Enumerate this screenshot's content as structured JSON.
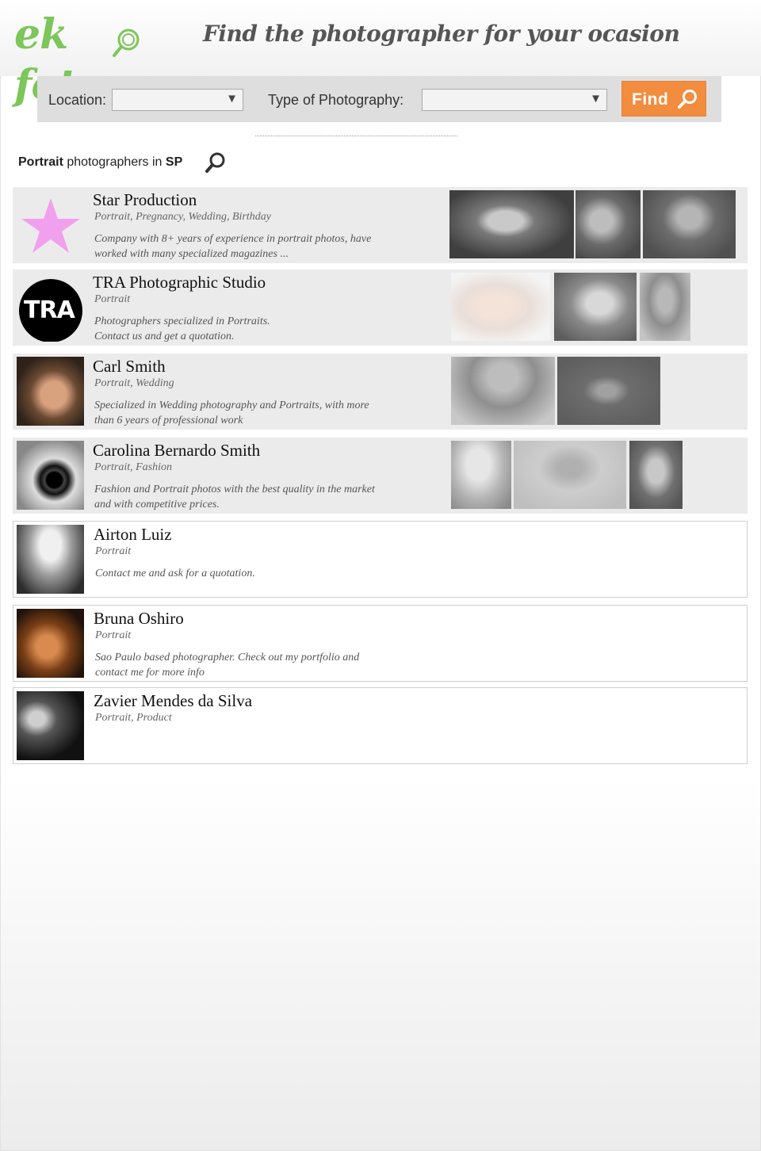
{
  "brand": {
    "logo_text": "ek foto",
    "tagline": "Find the photographer for your ocasion",
    "logo_color": "#7cc65a"
  },
  "search": {
    "location_label": "Location:",
    "location_value": "",
    "type_label": "Type of Photography:",
    "type_value": "",
    "find_label": "Find",
    "accent_color": "#f28c3f"
  },
  "results": {
    "heading_category": "Portrait",
    "heading_mid": " photographers in ",
    "heading_place": "SP"
  },
  "photographers": [
    {
      "name": "Star Production",
      "categories": "Portrait, Pregnancy, Wedding, Birthday",
      "description": "Company with 8+ years of experience in portrait photos, have worked with many specialized magazines  ...",
      "featured": true,
      "avatar_icon": "star-icon",
      "thumb_count": 3
    },
    {
      "name": "TRA Photographic Studio",
      "categories": "Portrait",
      "description": "Photographers specialized in Portraits. Contact us and get a quotation.",
      "featured": true,
      "avatar_text": "TRA",
      "thumb_count": 3
    },
    {
      "name": "Carl Smith",
      "categories": "Portrait, Wedding",
      "description": "Specialized in Wedding photography and Portraits, with more than 6 years of professional work",
      "featured": true,
      "thumb_count": 2
    },
    {
      "name": "Carolina Bernardo Smith",
      "categories": "Portrait, Fashion",
      "description": "Fashion and Portrait photos with the best quality in the market and with competitive prices.",
      "featured": true,
      "thumb_count": 3
    },
    {
      "name": "Airton Luiz",
      "categories": "Portrait",
      "description": "Contact me and ask for a quotation.",
      "featured": false,
      "thumb_count": 0
    },
    {
      "name": "Bruna Oshiro",
      "categories": "Portrait",
      "description": "Sao Paulo based photographer. Check out my portfolio and contact me for more info",
      "featured": false,
      "thumb_count": 0
    },
    {
      "name": "Zavier Mendes da Silva",
      "categories": "Portrait, Product",
      "description": "",
      "featured": false,
      "thumb_count": 0
    }
  ]
}
